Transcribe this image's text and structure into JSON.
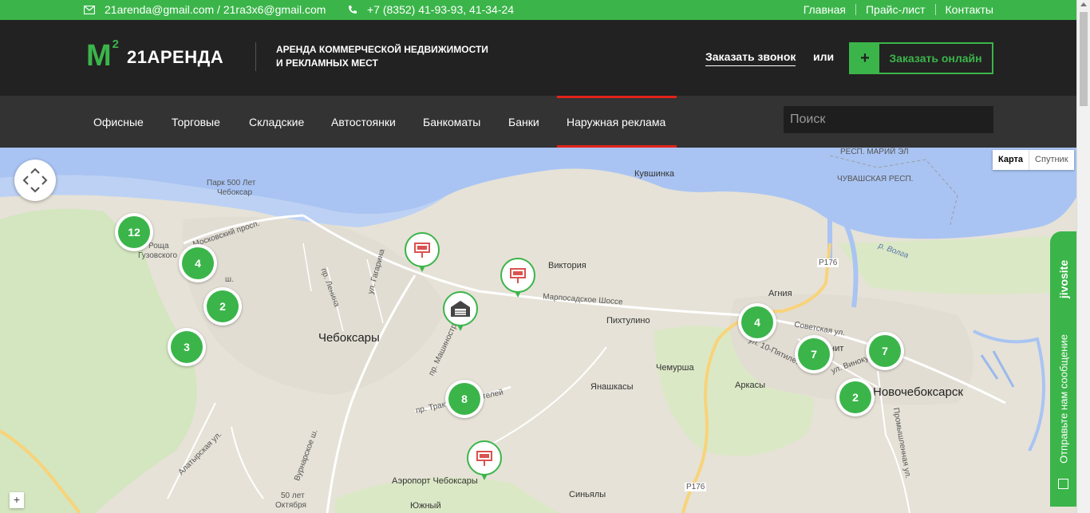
{
  "topbar": {
    "email": "21arenda@gmail.com / 21ra3x6@gmail.com",
    "phone": "+7 (8352) 41-93-93, 41-34-24",
    "links": [
      "Главная",
      "Прайс-лист",
      "Контакты"
    ],
    "icons": [
      "envelope-icon",
      "phone-icon"
    ]
  },
  "header": {
    "logo_mark": "M",
    "logo_sup": "2",
    "logo_name": "21АРЕНДА",
    "tagline_line1": "АРЕНДА КОММЕРЧЕСКОЙ НЕДВИЖИМОСТИ",
    "tagline_line2": "И РЕКЛАМНЫХ МЕСТ",
    "callback": "Заказать звонок",
    "or": "или",
    "order_plus": "+",
    "order_label": "Заказать онлайн"
  },
  "nav": {
    "items": [
      "Офисные",
      "Торговые",
      "Складские",
      "Автостоянки",
      "Банкоматы",
      "Банки",
      "Наружная реклама"
    ],
    "active_index": 6,
    "search_placeholder": "Поиск"
  },
  "map": {
    "type_buttons": [
      "Карта",
      "Спутник"
    ],
    "active_type": "Карта",
    "zoom_in": "+",
    "clusters": [
      "12",
      "4",
      "2",
      "3",
      "8",
      "4",
      "7",
      "7",
      "2"
    ],
    "places": {
      "cheboksary": "Чебоксары",
      "novocheboksarsk": "Новочебоксарск",
      "kuvshinka": "Кувшинка",
      "viktoriya": "Виктория",
      "pikhtulino": "Пихтулино",
      "agniya": "Агния",
      "chemursha": "Чемурша",
      "yanashkasy": "Янашкасы",
      "arkasy": "Аркасы",
      "sinyaly": "Синьялы",
      "airport": "Аэропорт Чебоксары",
      "yuzhny": "Южный",
      "park_l1": "Парк 500 Лет",
      "park_l2": "Чебоксар",
      "roshcha_l1": "Роща",
      "roshcha_l2": "Гузовского",
      "fifty_l1": "50 лет",
      "fifty_l2": "Октября",
      "chuvash": "ЧУВАШСКАЯ РЕСП.",
      "mariy": "РЕСП. МАРИЙ ЭЛ",
      "volga": "р. Волга",
      "p176a": "P176",
      "p176b": "P176",
      "marposad": "Марпосадское Шоссе",
      "sovetskaya": "Советская ул.",
      "moskovsky": "Московский просп.",
      "lenina": "пр. Ленина",
      "gagarina": "ул. Гагарина",
      "mashinostr": "пр. Машиностр",
      "traktor": "пр. Тракторостроителей",
      "pyatiletki": "ул. 10-Пятилетки",
      "vinokur": "ул. Винокурова",
      "prom": "Промышленная ул.",
      "vurnar": "Вурнарское ш.",
      "alatyr": "Алатырская ул.",
      "shosse_k": "ш.",
      "nit": "нит"
    },
    "colors": {
      "water": "#a9c4f3",
      "land": "#e6e2d7",
      "green": "#cfe5b8",
      "road_major": "#f8d37a",
      "cluster": "#3bb54a"
    }
  },
  "jivosite": {
    "brand": "jivosite",
    "message": "Отправьте нам сообщение"
  }
}
